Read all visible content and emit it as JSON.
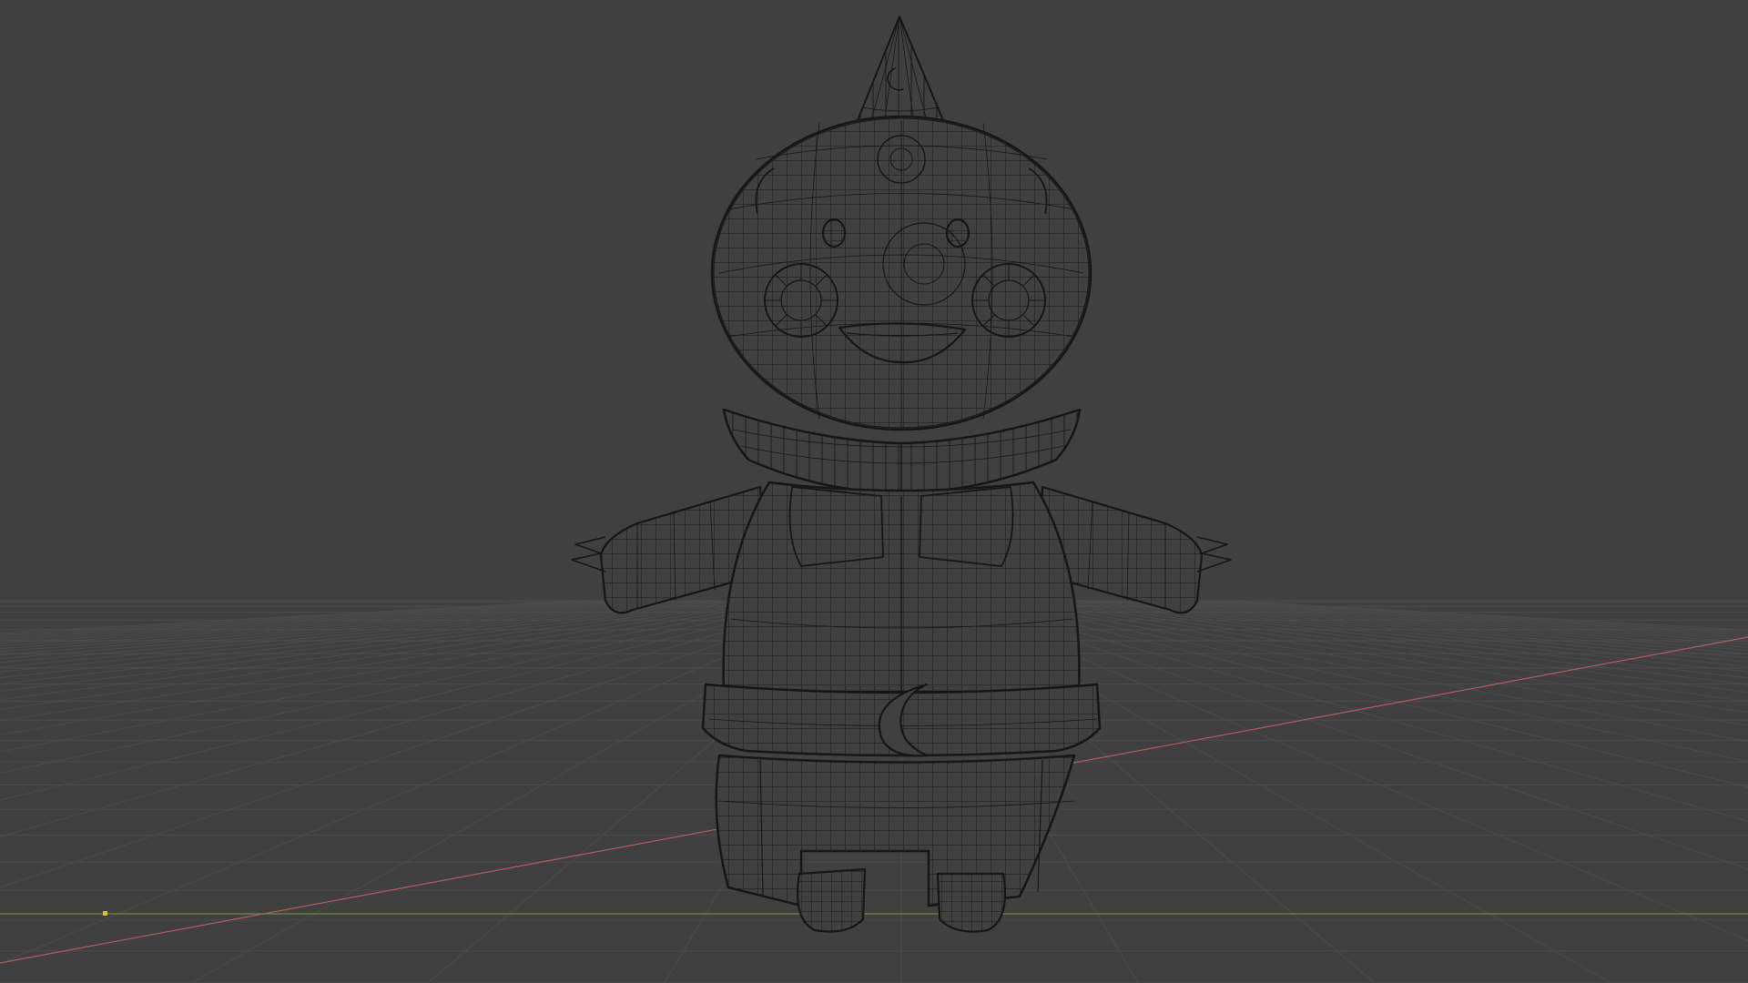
{
  "viewport": {
    "background": "#404040",
    "grid_color": "#4b4b4b",
    "x_axis_color": "#b35a63",
    "y_axis_color": "#6b8e3a",
    "wire_color": "#161616",
    "origin_marker_color": "#f2b333"
  },
  "model": {
    "view_mode": "wireframe",
    "hat_emblem": "crescent-moon",
    "belt_emblem": "crescent-moon"
  }
}
